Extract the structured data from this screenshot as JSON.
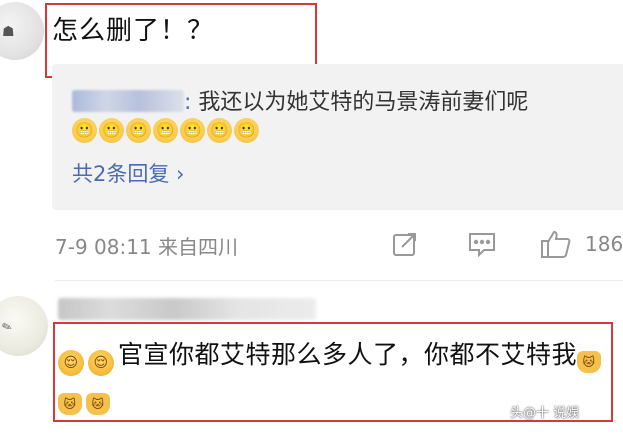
{
  "comment1": {
    "text": "怎么删了！？"
  },
  "reply": {
    "text": "我还以为她艾特的马景涛前妻们呢",
    "colon": ": ",
    "emojis": [
      "😬",
      "😬",
      "😬",
      "😬",
      "😬",
      "😬",
      "😬"
    ],
    "more_replies": "共2条回复 ›"
  },
  "meta": {
    "time": "7-9 08:11 来自四川",
    "like_count": "186"
  },
  "comment2": {
    "emoji_prefix": [
      "😌",
      "😌"
    ],
    "text": "官宣你都艾特那么多人了，你都不艾特我",
    "cat_emojis": [
      "🐱",
      "🐱",
      "🐱"
    ]
  },
  "watermark": "头@十  说娱",
  "icons": {
    "share": "share-icon",
    "comment": "comment-icon",
    "like": "like-icon"
  },
  "colors": {
    "highlight": "#d43a3a",
    "link": "#4a6bb3"
  }
}
